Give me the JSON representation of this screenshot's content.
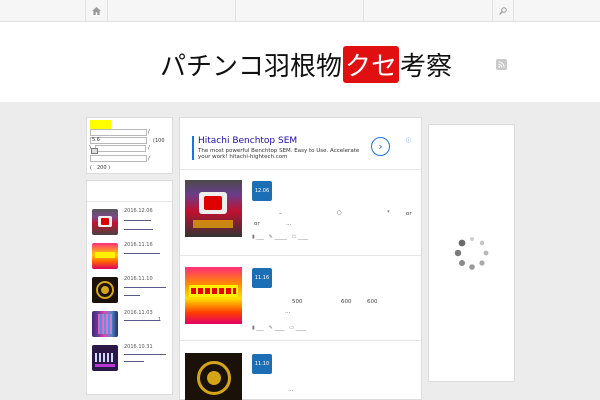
{
  "site": {
    "title_pre": "パチンコ羽根物",
    "title_highlight": "クセ",
    "title_post": "考察"
  },
  "nav": {
    "home_icon": "home-icon",
    "search_icon": "search-icon",
    "rss_icon": "rss-icon"
  },
  "counter": {
    "field1_value": "5.6",
    "label_slash1": "/",
    "label_100": "(100",
    "label_paren": ")",
    "label_slash2": "/",
    "label_slash3": "/",
    "label_200": "(　200 )"
  },
  "recent": {
    "items": [
      {
        "date": "2016.12.06"
      },
      {
        "date": "2016.11.16"
      },
      {
        "date": "2016.11.10"
      },
      {
        "date": "2016.11.03",
        "num": "1"
      },
      {
        "date": "2016.10.31"
      }
    ]
  },
  "ad": {
    "title": "Hitachi Benchtop SEM",
    "desc": "The most powerful Benchtop SEM. Easy to Use. Accelerate your work! hitachi-hightech.com",
    "arrow": "›",
    "info": "ⓘ"
  },
  "posts": [
    {
      "date": "12.06",
      "line1_a": "–",
      "line1_b": "○",
      "line1_c": "*",
      "line1_d": "or",
      "line2_a": "or",
      "line2_b": "…",
      "meta_a": "___",
      "meta_b": "_____",
      "meta_c": "____"
    },
    {
      "date": "11.16",
      "line1_a": "500",
      "line1_b": "600",
      "line1_c": "600",
      "line2_a": "…",
      "meta_a": "___",
      "meta_b": "____",
      "meta_c": "____"
    },
    {
      "date": "11.10",
      "line1_a": "…"
    }
  ],
  "colors": {
    "badge": "#1d6fb5",
    "highlight": "#e01010",
    "counter_swatch": "#ffff00"
  }
}
